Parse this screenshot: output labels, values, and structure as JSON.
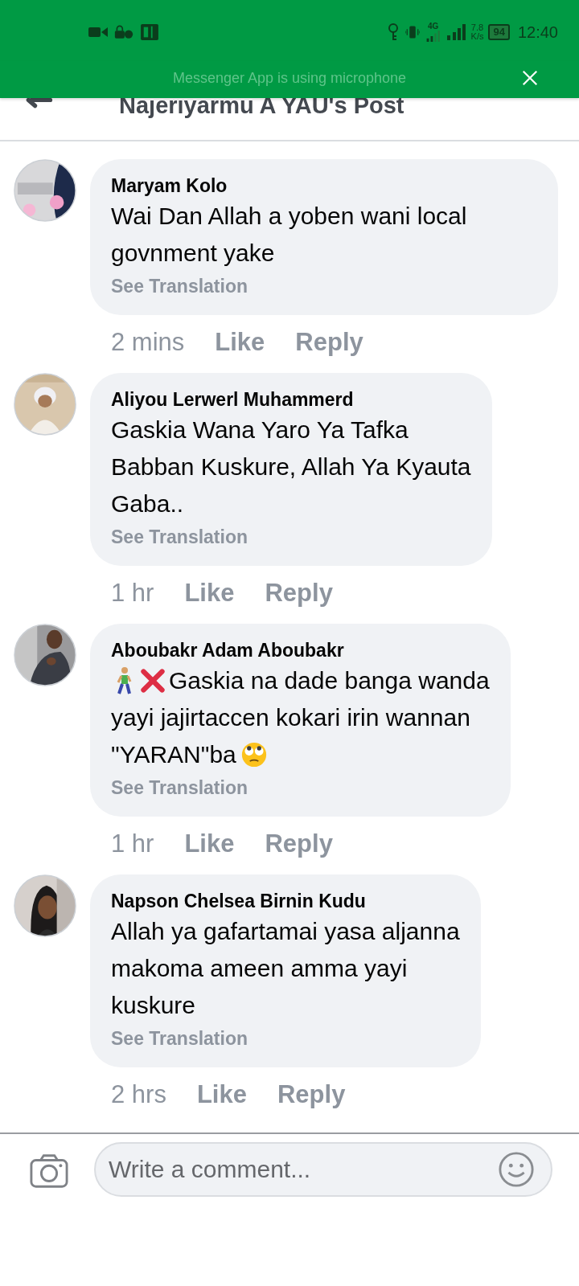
{
  "status_bar": {
    "network": "4G",
    "speed_value": "7.8",
    "speed_unit": "K/s",
    "battery": "94",
    "time": "12:40"
  },
  "banner": {
    "text": "Messenger App is using microphone"
  },
  "header": {
    "title": "Najeriyarmu A YAU's Post"
  },
  "comments": [
    {
      "author": "Maryam Kolo",
      "body": [
        [
          {
            "kind": "text",
            "text": "Wai Dan Allah a yoben wani local govnment yake"
          }
        ]
      ],
      "translation": "See Translation",
      "time": "2 mins",
      "like": "Like",
      "reply": "Reply"
    },
    {
      "author": "Aliyou Lerwerl Muhammerd",
      "body": [
        [
          {
            "kind": "text",
            "text": "Gaskia Wana Yaro Ya Tafka\nBabban Kuskure, Allah Ya Kyauta\nGaba.."
          }
        ]
      ],
      "translation": "See Translation",
      "time": "1 hr",
      "like": "Like",
      "reply": "Reply"
    },
    {
      "author": "Aboubakr Adam Aboubakr",
      "body": [
        [
          {
            "kind": "walker"
          },
          {
            "kind": "cross"
          },
          {
            "kind": "text",
            "text": "Gaskia na dade banga wanda"
          }
        ],
        [
          {
            "kind": "text",
            "text": "yayi jajirtaccen kokari irin wannan"
          }
        ],
        [
          {
            "kind": "text",
            "text": "\"YARAN\"ba"
          },
          {
            "kind": "eyeroll"
          }
        ]
      ],
      "translation": "See Translation",
      "time": "1 hr",
      "like": "Like",
      "reply": "Reply"
    },
    {
      "author": "Napson Chelsea Birnin Kudu",
      "body": [
        [
          {
            "kind": "text",
            "text": "Allah ya gafartamai yasa aljanna\nmakoma ameen amma yayi\nkuskure"
          }
        ]
      ],
      "translation": "See Translation",
      "time": "2 hrs",
      "like": "Like",
      "reply": "Reply"
    }
  ],
  "composer": {
    "placeholder": "Write a comment..."
  }
}
